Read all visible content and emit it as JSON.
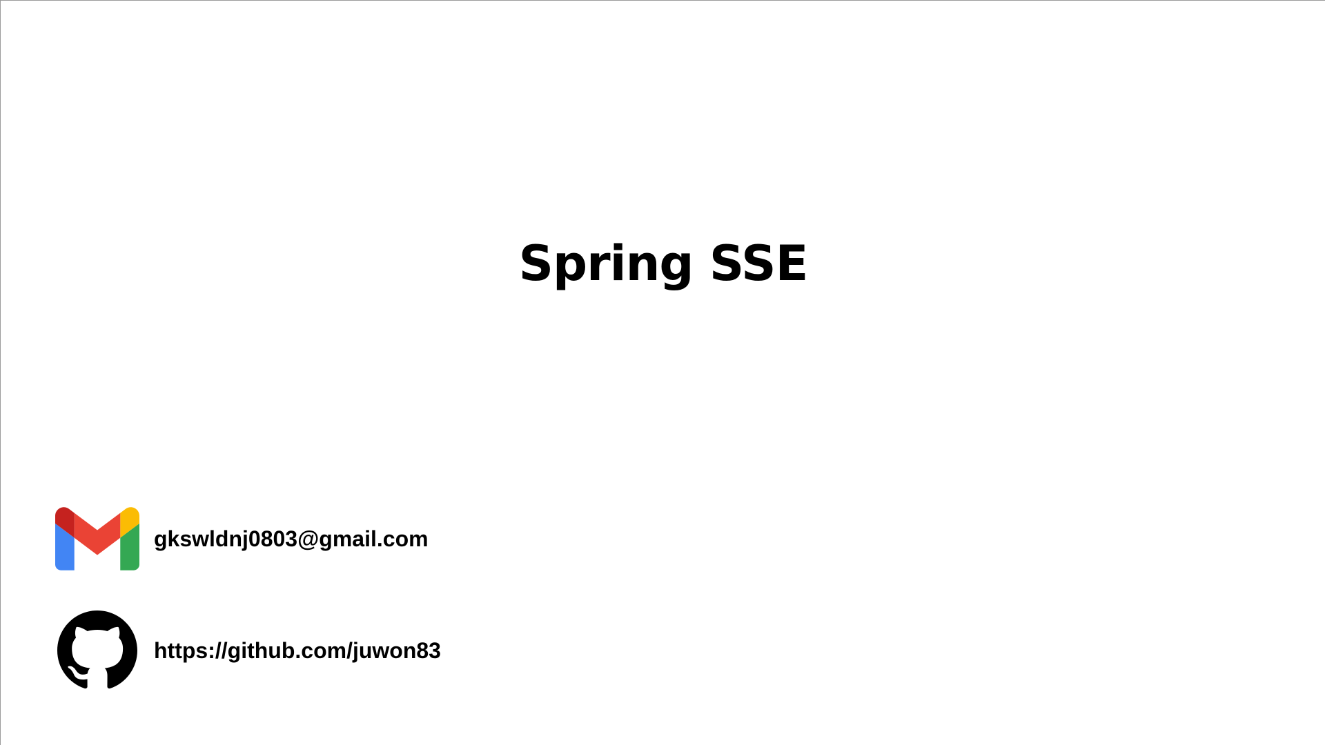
{
  "slide": {
    "title": "Spring SSE",
    "contacts": {
      "email": {
        "icon": "gmail-icon",
        "text": "gkswldnj0803@gmail.com"
      },
      "github": {
        "icon": "github-icon",
        "text": "https://github.com/juwon83"
      }
    }
  },
  "colors": {
    "background": "#ffffff",
    "text": "#000000",
    "gmail_red": "#EA4335",
    "gmail_dark_red": "#C5221F",
    "gmail_blue": "#4285F4",
    "gmail_green": "#34A853",
    "gmail_yellow": "#FBBC04"
  }
}
